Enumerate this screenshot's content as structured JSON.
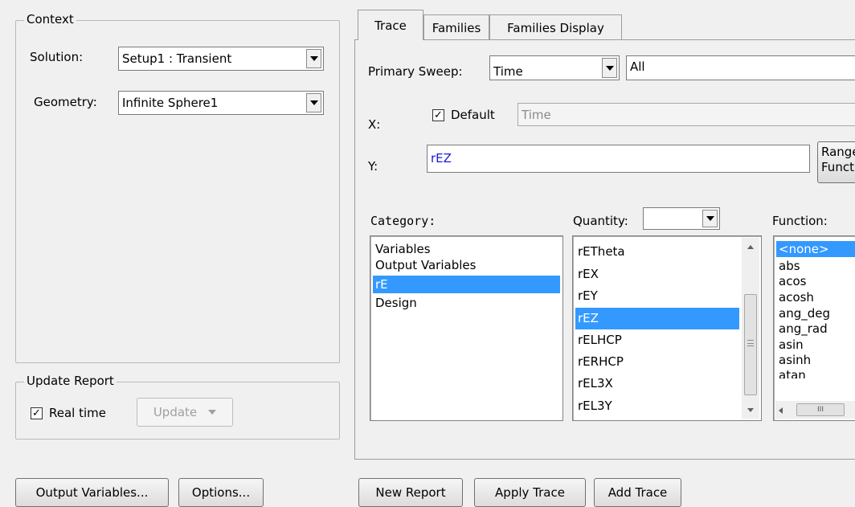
{
  "context": {
    "title": "Context",
    "solution_label": "Solution:",
    "solution_value": "Setup1 : Transient",
    "geometry_label": "Geometry:",
    "geometry_value": "Infinite Sphere1"
  },
  "update_report": {
    "title": "Update Report",
    "realtime_label": "Real time",
    "realtime_checked": true,
    "update_button": "Update"
  },
  "bottom_left_buttons": {
    "output_variables": "Output Variables...",
    "options": "Options..."
  },
  "tabs": [
    "Trace",
    "Families",
    "Families Display"
  ],
  "active_tab": "Trace",
  "trace": {
    "primary_sweep_label": "Primary Sweep:",
    "primary_sweep_value": "Time",
    "primary_sweep_range": "All",
    "x_label": "X:",
    "x_default_label": "Default",
    "x_default_checked": true,
    "x_value": "Time",
    "y_label": "Y:",
    "y_value": "rEZ",
    "range_function_button": [
      "Range",
      "Function"
    ],
    "category_label": "Category:",
    "category_items": [
      "Variables",
      "Output Variables",
      "rE",
      "Design"
    ],
    "category_selected": "rE",
    "quantity_label": "Quantity:",
    "quantity_filter_value": "",
    "quantity_items": [
      "rETheta",
      "rEX",
      "rEY",
      "rEZ",
      "rELHCP",
      "rERHCP",
      "rEL3X",
      "rEL3Y"
    ],
    "quantity_selected": "rEZ",
    "function_label": "Function:",
    "function_items": [
      "<none>",
      "abs",
      "acos",
      "acosh",
      "ang_deg",
      "ang_rad",
      "asin",
      "asinh",
      "atan"
    ],
    "function_selected": "<none>",
    "hscroll_thumb_glyph": "III"
  },
  "bottom_right_buttons": {
    "new_report": "New Report",
    "apply_trace": "Apply Trace",
    "add_trace": "Add Trace"
  },
  "colors": {
    "selection": "#3399ff",
    "y_text": "#1a1ad8",
    "background": "#f0f0f0"
  }
}
